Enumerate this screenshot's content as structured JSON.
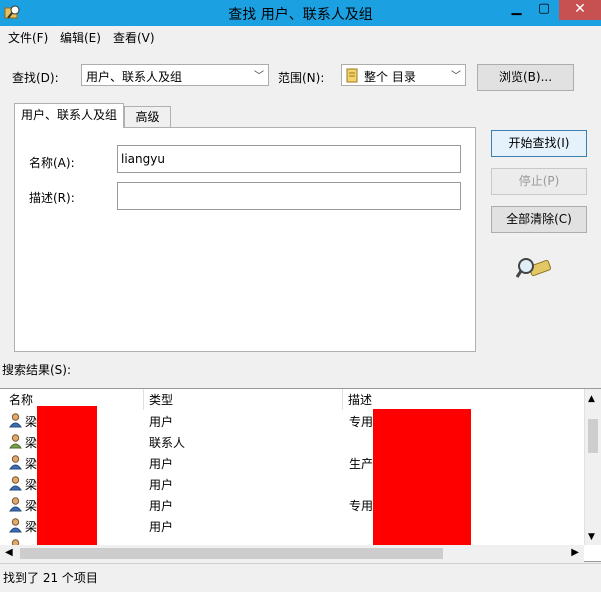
{
  "window": {
    "title": "查找 用户、联系人及组",
    "min_glyph": "▁",
    "max_glyph": "▢",
    "close_glyph": "✕"
  },
  "menu": {
    "items": [
      "文件(F)",
      "编辑(E)",
      "查看(V)"
    ]
  },
  "search": {
    "find_label": "查找(D):",
    "find_value": "用户、联系人及组",
    "scope_label": "范围(N):",
    "scope_value": "整个 目录",
    "browse_label": "浏览(B)..."
  },
  "tabs": [
    {
      "label": "用户、联系人及组",
      "active": true
    },
    {
      "label": "高级",
      "active": false
    }
  ],
  "form": {
    "name_label": "名称(A):",
    "name_value": "liangyu",
    "desc_label": "描述(R):",
    "desc_value": ""
  },
  "actions": {
    "start_label": "开始查找(I)",
    "stop_label": "停止(P)",
    "clear_label": "全部清除(C)"
  },
  "results": {
    "label": "搜索结果(S):",
    "columns": [
      "名称",
      "类型",
      "描述"
    ],
    "rows": [
      {
        "name": "梁",
        "type": "用户",
        "desc": "专用"
      },
      {
        "name": "梁",
        "type": "联系人",
        "desc": ""
      },
      {
        "name": "梁",
        "type": "用户",
        "desc": "生产"
      },
      {
        "name": "梁",
        "type": "用户",
        "desc": ""
      },
      {
        "name": "梁",
        "type": "用户",
        "desc": "专用"
      },
      {
        "name": "梁",
        "type": "用户",
        "desc": ""
      }
    ]
  },
  "status": {
    "text": "找到了 21 个项目"
  },
  "colors": {
    "titlebar": "#1ba1e2",
    "close": "#c75050",
    "redaction": "#ff0000"
  },
  "icons": [
    "app-icon",
    "directory-icon",
    "search-magnifier-icon",
    "user-icon",
    "contact-icon"
  ]
}
